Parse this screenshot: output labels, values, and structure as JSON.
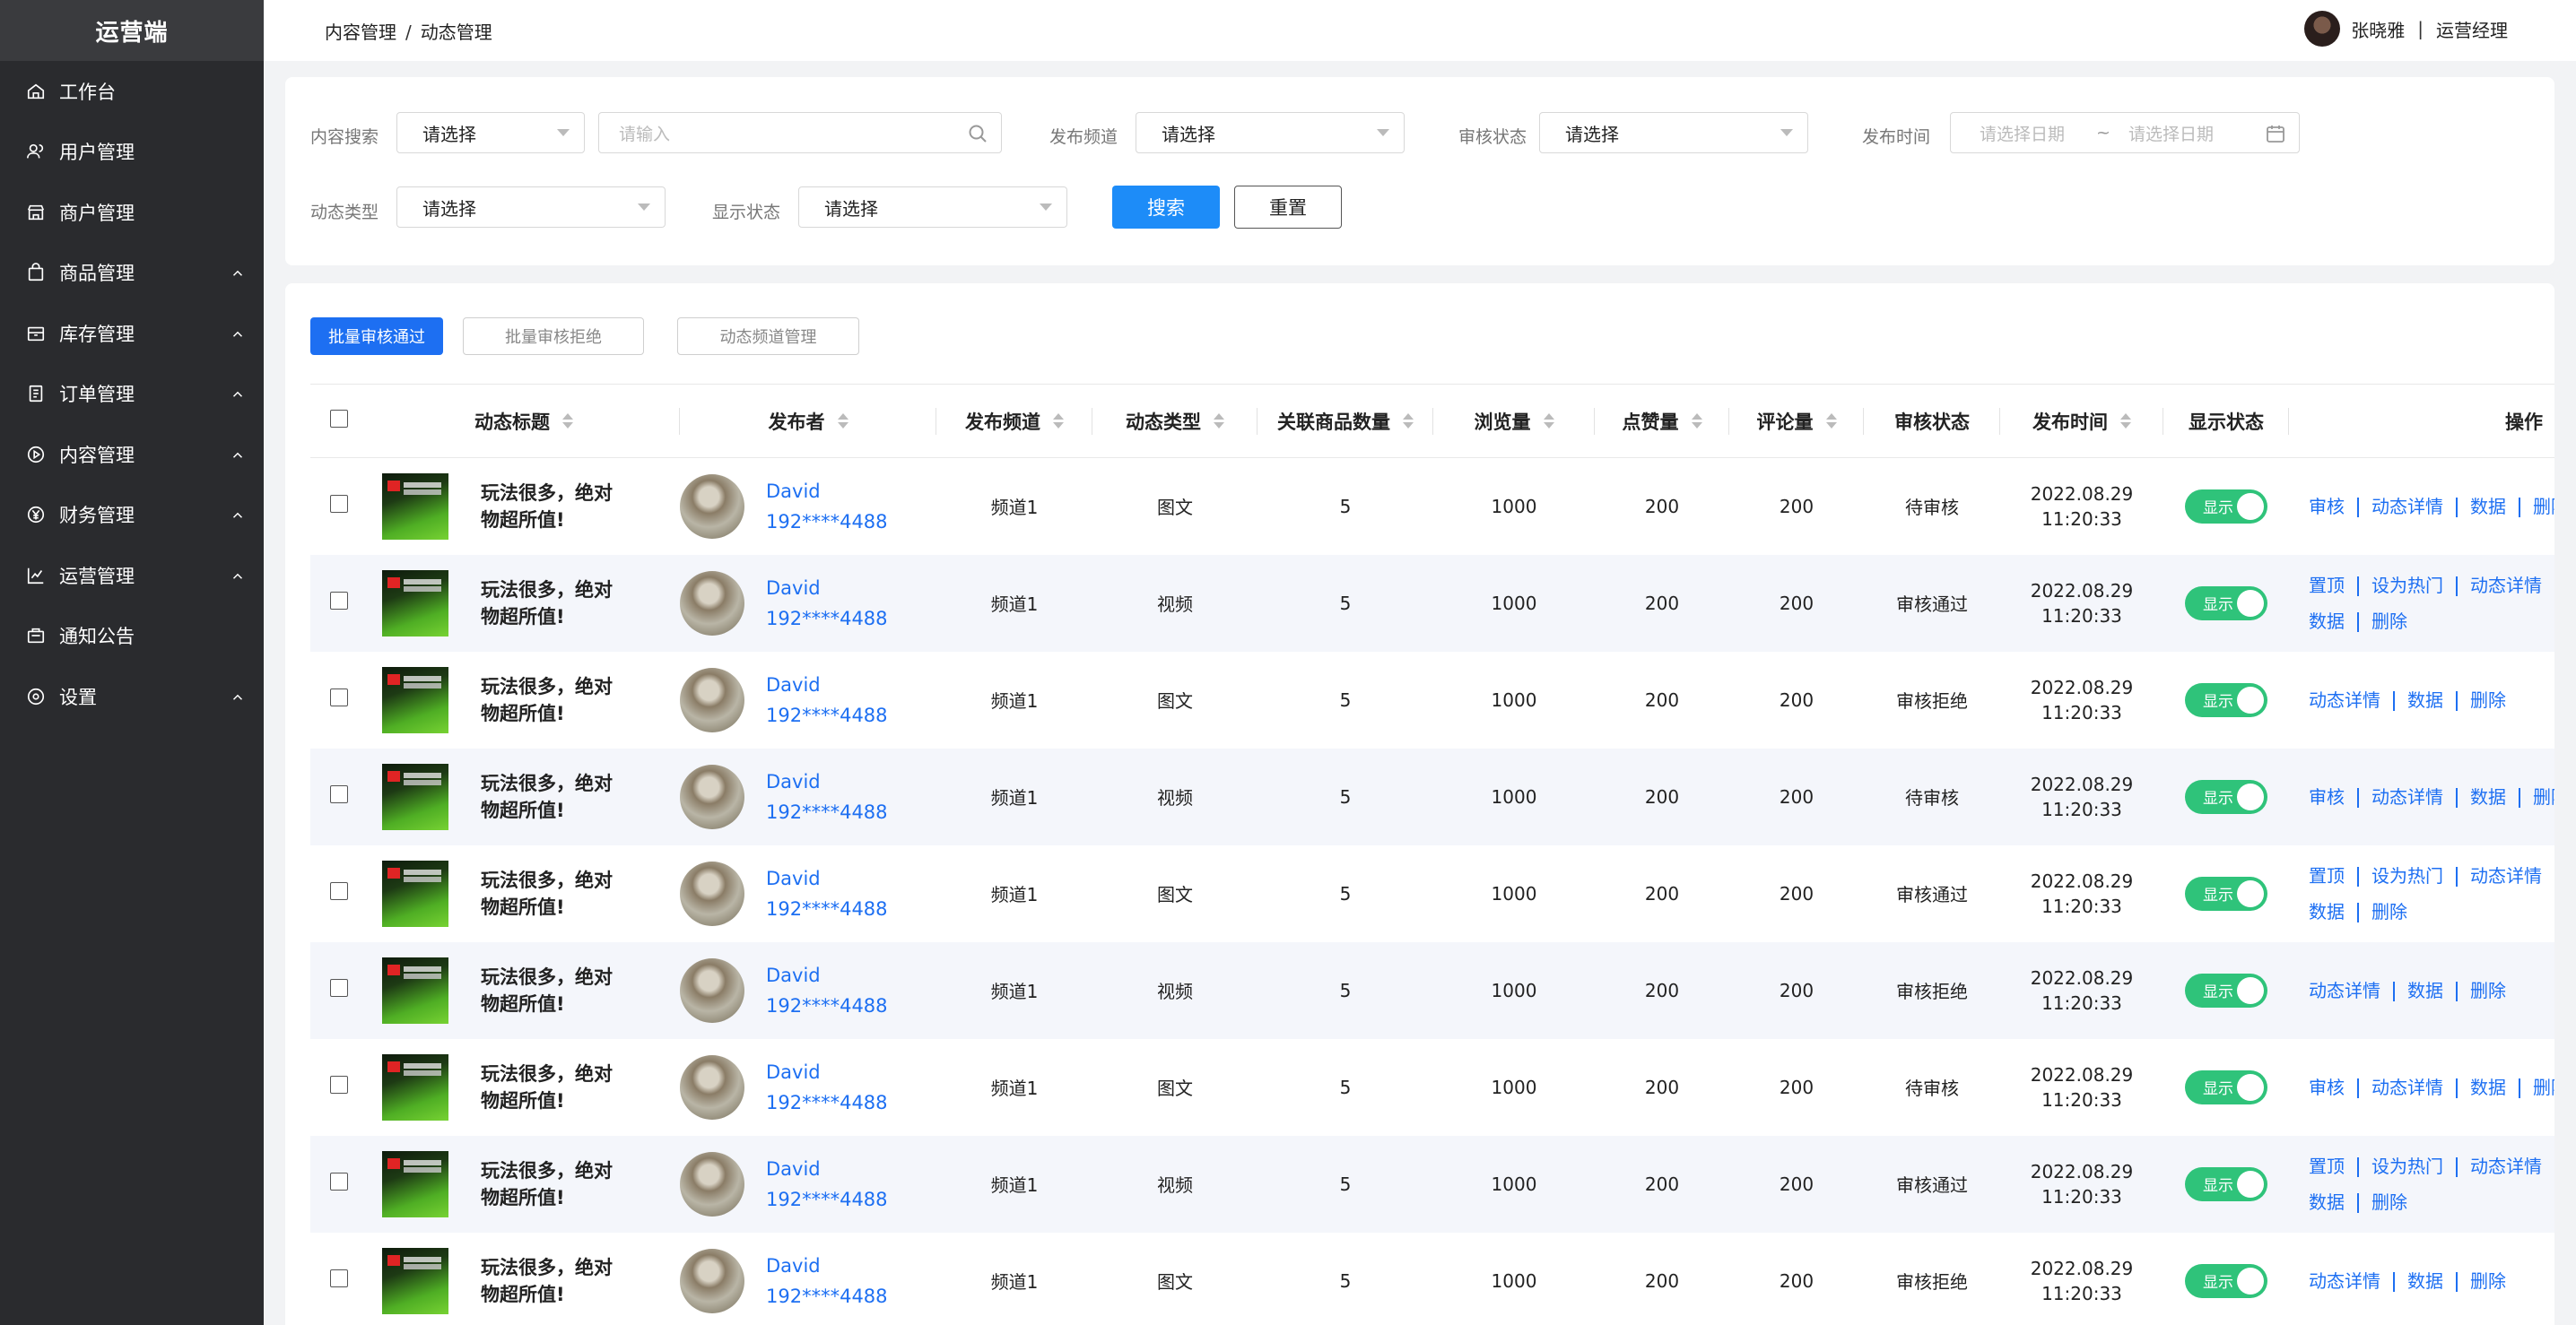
{
  "sidebar": {
    "brand": "运营端",
    "items": [
      {
        "label": "工作台",
        "icon": "home-icon",
        "chevron": false
      },
      {
        "label": "用户管理",
        "icon": "user-icon",
        "chevron": false
      },
      {
        "label": "商户管理",
        "icon": "store-icon",
        "chevron": false
      },
      {
        "label": "商品管理",
        "icon": "bag-icon",
        "chevron": true
      },
      {
        "label": "库存管理",
        "icon": "box-icon",
        "chevron": true
      },
      {
        "label": "订单管理",
        "icon": "order-icon",
        "chevron": true
      },
      {
        "label": "内容管理",
        "icon": "play-icon",
        "chevron": true
      },
      {
        "label": "财务管理",
        "icon": "yen-icon",
        "chevron": true
      },
      {
        "label": "运营管理",
        "icon": "chart-icon",
        "chevron": true
      },
      {
        "label": "通知公告",
        "icon": "notice-icon",
        "chevron": false
      },
      {
        "label": "设置",
        "icon": "settings-icon",
        "chevron": true
      }
    ]
  },
  "topbar": {
    "breadcrumb_parent": "内容管理",
    "breadcrumb_sep": "/",
    "breadcrumb_current": "动态管理",
    "user_name": "张晓雅",
    "user_sep": "|",
    "user_role": "运营经理"
  },
  "filters": {
    "content_search_label": "内容搜索",
    "content_search_select": "请选择",
    "content_search_placeholder": "请输入",
    "channel_label": "发布频道",
    "channel_select": "请选择",
    "audit_label": "审核状态",
    "audit_select": "请选择",
    "time_label": "发布时间",
    "date_start": "请选择日期",
    "date_sep": "~",
    "date_end": "请选择日期",
    "type_label": "动态类型",
    "type_select": "请选择",
    "display_label": "显示状态",
    "display_select": "请选择",
    "search_button": "搜索",
    "reset_button": "重置"
  },
  "actions": {
    "batch_approve": "批量审核通过",
    "batch_reject": "批量审核拒绝",
    "channel_manage": "动态频道管理"
  },
  "table": {
    "headers": {
      "title": "动态标题",
      "publisher": "发布者",
      "channel": "发布频道",
      "type": "动态类型",
      "goods": "关联商品数量",
      "views": "浏览量",
      "likes": "点赞量",
      "comments": "评论量",
      "audit": "审核状态",
      "time": "发布时间",
      "display": "显示状态",
      "ops": "操作"
    },
    "rows": [
      {
        "title": "玩法很多，绝对物超所值!",
        "name": "David",
        "phone": "192****4488",
        "channel": "频道1",
        "type": "图文",
        "goods": "5",
        "views": "1000",
        "likes": "200",
        "comments": "200",
        "audit": "待审核",
        "date": "2022.08.29",
        "time": "11:20:33",
        "display": "显示",
        "ops": [
          "审核",
          "动态详情",
          "数据",
          "删除"
        ]
      },
      {
        "title": "玩法很多，绝对物超所值!",
        "name": "David",
        "phone": "192****4488",
        "channel": "频道1",
        "type": "视频",
        "goods": "5",
        "views": "1000",
        "likes": "200",
        "comments": "200",
        "audit": "审核通过",
        "date": "2022.08.29",
        "time": "11:20:33",
        "display": "显示",
        "ops": [
          "置顶",
          "设为热门",
          "动态详情",
          "数据",
          "删除"
        ]
      },
      {
        "title": "玩法很多，绝对物超所值!",
        "name": "David",
        "phone": "192****4488",
        "channel": "频道1",
        "type": "图文",
        "goods": "5",
        "views": "1000",
        "likes": "200",
        "comments": "200",
        "audit": "审核拒绝",
        "date": "2022.08.29",
        "time": "11:20:33",
        "display": "显示",
        "ops": [
          "动态详情",
          "数据",
          "删除"
        ]
      },
      {
        "title": "玩法很多，绝对物超所值!",
        "name": "David",
        "phone": "192****4488",
        "channel": "频道1",
        "type": "视频",
        "goods": "5",
        "views": "1000",
        "likes": "200",
        "comments": "200",
        "audit": "待审核",
        "date": "2022.08.29",
        "time": "11:20:33",
        "display": "显示",
        "ops": [
          "审核",
          "动态详情",
          "数据",
          "删除"
        ]
      },
      {
        "title": "玩法很多，绝对物超所值!",
        "name": "David",
        "phone": "192****4488",
        "channel": "频道1",
        "type": "图文",
        "goods": "5",
        "views": "1000",
        "likes": "200",
        "comments": "200",
        "audit": "审核通过",
        "date": "2022.08.29",
        "time": "11:20:33",
        "display": "显示",
        "ops": [
          "置顶",
          "设为热门",
          "动态详情",
          "数据",
          "删除"
        ]
      },
      {
        "title": "玩法很多，绝对物超所值!",
        "name": "David",
        "phone": "192****4488",
        "channel": "频道1",
        "type": "视频",
        "goods": "5",
        "views": "1000",
        "likes": "200",
        "comments": "200",
        "audit": "审核拒绝",
        "date": "2022.08.29",
        "time": "11:20:33",
        "display": "显示",
        "ops": [
          "动态详情",
          "数据",
          "删除"
        ]
      },
      {
        "title": "玩法很多，绝对物超所值!",
        "name": "David",
        "phone": "192****4488",
        "channel": "频道1",
        "type": "图文",
        "goods": "5",
        "views": "1000",
        "likes": "200",
        "comments": "200",
        "audit": "待审核",
        "date": "2022.08.29",
        "time": "11:20:33",
        "display": "显示",
        "ops": [
          "审核",
          "动态详情",
          "数据",
          "删除"
        ]
      },
      {
        "title": "玩法很多，绝对物超所值!",
        "name": "David",
        "phone": "192****4488",
        "channel": "频道1",
        "type": "视频",
        "goods": "5",
        "views": "1000",
        "likes": "200",
        "comments": "200",
        "audit": "审核通过",
        "date": "2022.08.29",
        "time": "11:20:33",
        "display": "显示",
        "ops": [
          "置顶",
          "设为热门",
          "动态详情",
          "数据",
          "删除"
        ]
      },
      {
        "title": "玩法很多，绝对物超所值!",
        "name": "David",
        "phone": "192****4488",
        "channel": "频道1",
        "type": "图文",
        "goods": "5",
        "views": "1000",
        "likes": "200",
        "comments": "200",
        "audit": "审核拒绝",
        "date": "2022.08.29",
        "time": "11:20:33",
        "display": "显示",
        "ops": [
          "动态详情",
          "数据",
          "删除"
        ]
      }
    ]
  },
  "colors": {
    "sidebar_bg": "#2a2b2e",
    "primary": "#1d8cf8",
    "link": "#1d6ff2",
    "toggle_on": "#2fc37a"
  }
}
